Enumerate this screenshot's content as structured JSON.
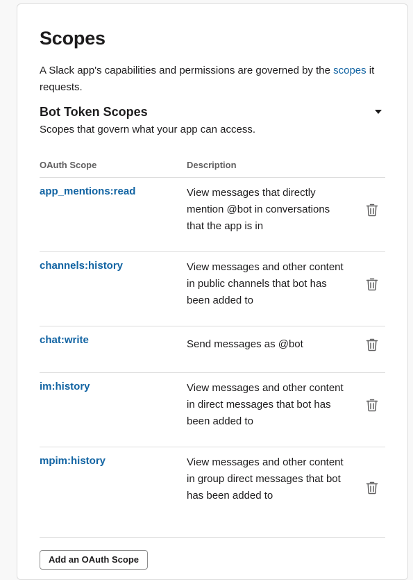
{
  "panel": {
    "title": "Scopes",
    "intro_before": "A Slack app's capabilities and permissions are governed by the ",
    "intro_link": "scopes",
    "intro_after": " it requests."
  },
  "bot_token": {
    "title": "Bot Token Scopes",
    "description": "Scopes that govern what your app can access."
  },
  "table": {
    "headers": [
      "OAuth Scope",
      "Description"
    ],
    "rows": [
      {
        "scope": "app_mentions:read",
        "description": "View messages that directly mention @bot in conversations that the app is in"
      },
      {
        "scope": "channels:history",
        "description": "View messages and other content in public channels that bot has been added to"
      },
      {
        "scope": "chat:write",
        "description": "Send messages as @bot"
      },
      {
        "scope": "im:history",
        "description": "View messages and other content in direct messages that bot has been added to"
      },
      {
        "scope": "mpim:history",
        "description": "View messages and other content in group direct messages that bot has been added to"
      }
    ]
  },
  "actions": {
    "add_scope_label": "Add an OAuth Scope"
  },
  "icons": {
    "row_action": "trash-icon",
    "collapse": "caret-down-icon"
  },
  "colors": {
    "link": "#1264a3",
    "text": "#1d1c1d",
    "muted": "#616061",
    "divider": "#dddddd"
  }
}
